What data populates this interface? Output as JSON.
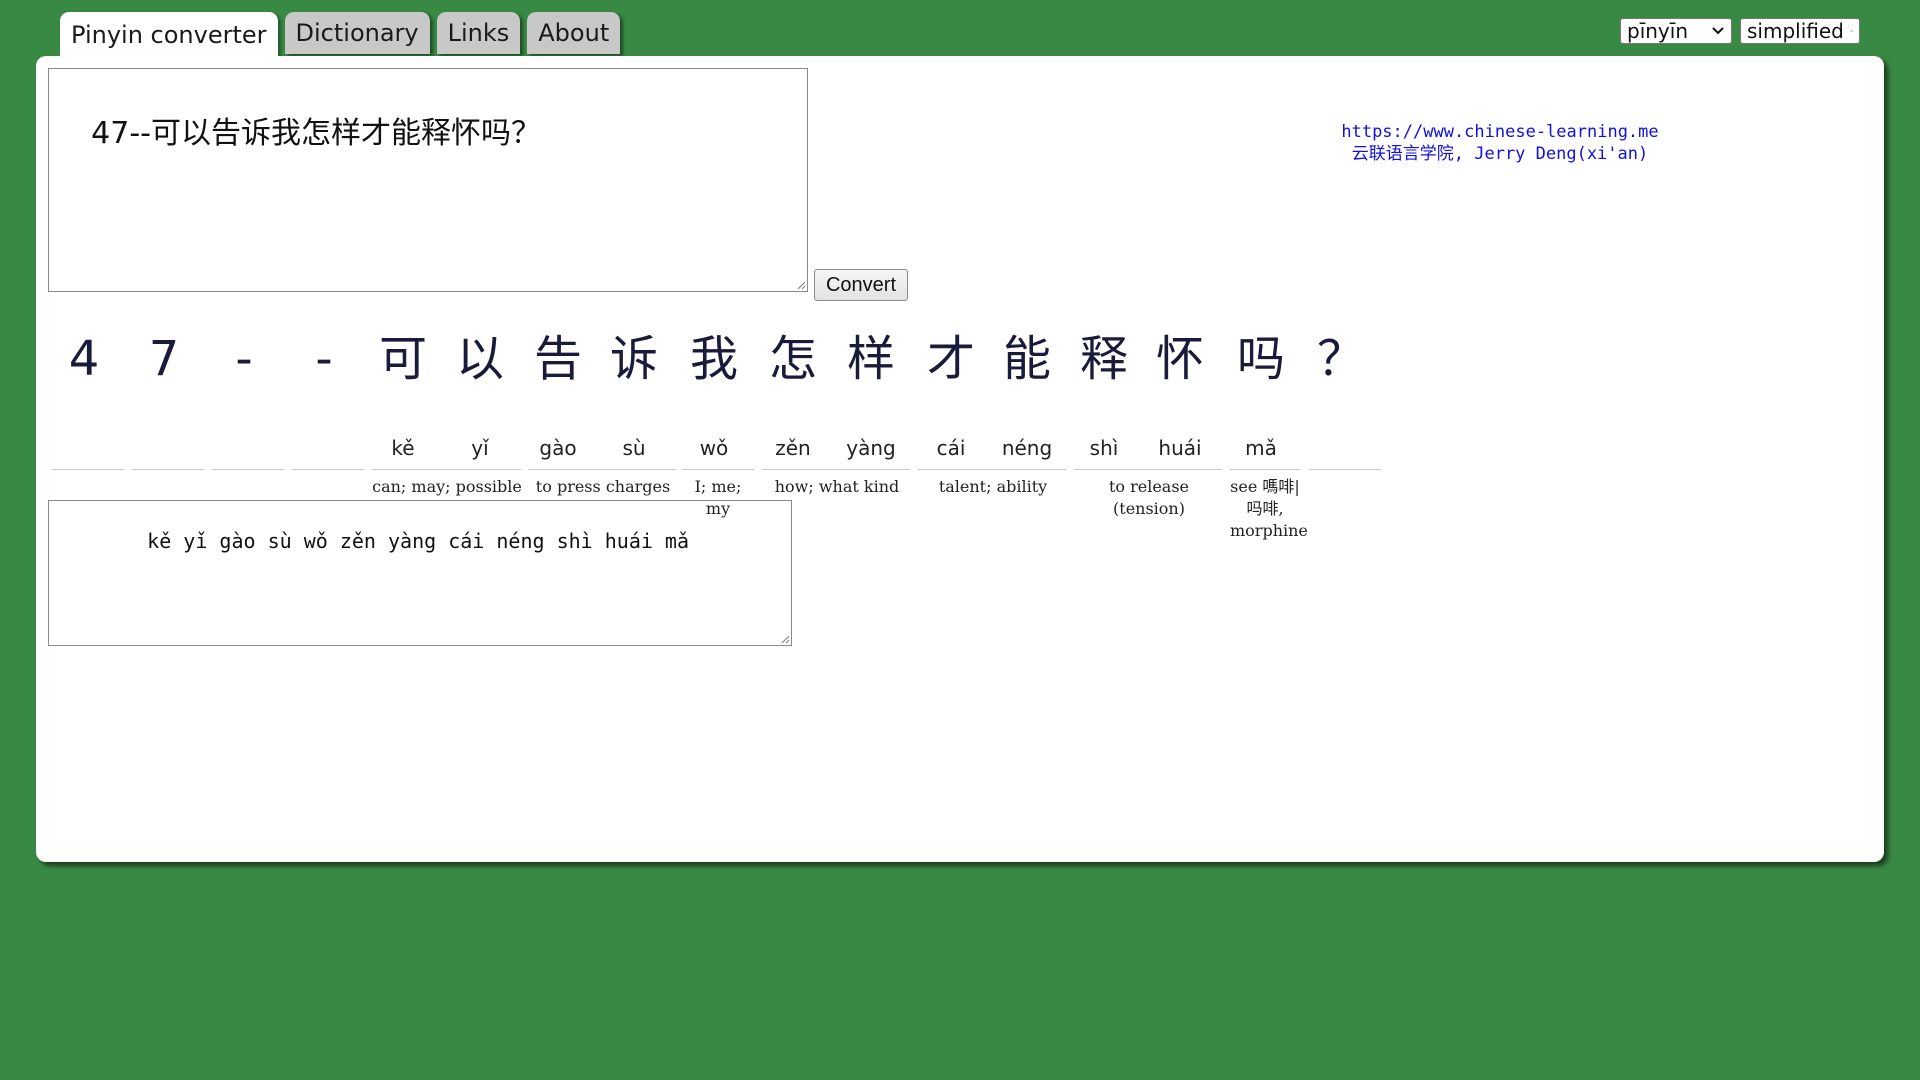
{
  "tabs": [
    {
      "label": "Pinyin converter",
      "active": true
    },
    {
      "label": "Dictionary",
      "active": false
    },
    {
      "label": "Links",
      "active": false
    },
    {
      "label": "About",
      "active": false
    }
  ],
  "selects": {
    "tone_mode": "pīnyīn",
    "script": "simplified"
  },
  "input": {
    "text": "47--可以告诉我怎样才能释怀吗？"
  },
  "convert_label": "Convert",
  "credit": {
    "url": "https://www.chinese-learning.me",
    "author": "云联语言学院, Jerry Deng(xi'an)"
  },
  "characters": [
    {
      "char": "4",
      "pinyin": ""
    },
    {
      "char": "7",
      "pinyin": ""
    },
    {
      "char": "-",
      "pinyin": ""
    },
    {
      "char": "-",
      "pinyin": ""
    },
    {
      "char": "可",
      "pinyin": "kě"
    },
    {
      "char": "以",
      "pinyin": "yǐ"
    },
    {
      "char": "告",
      "pinyin": "gào"
    },
    {
      "char": "诉",
      "pinyin": "sù"
    },
    {
      "char": "我",
      "pinyin": "wǒ"
    },
    {
      "char": "怎",
      "pinyin": "zěn"
    },
    {
      "char": "样",
      "pinyin": "yàng"
    },
    {
      "char": "才",
      "pinyin": "cái"
    },
    {
      "char": "能",
      "pinyin": "néng"
    },
    {
      "char": "释",
      "pinyin": "shì"
    },
    {
      "char": "怀",
      "pinyin": "huái"
    },
    {
      "char": "吗",
      "pinyin": "mǎ"
    },
    {
      "char": "？",
      "pinyin": ""
    }
  ],
  "definitions": [
    "can; may; possible",
    "to press charges",
    "I; me; my",
    "how; what kind",
    "talent; ability",
    "to release (tension)",
    "see 嗎啡|吗啡, morphine"
  ],
  "output": {
    "text": "kě yǐ gào sù wǒ zěn yàng cái néng shì huái mǎ"
  },
  "colors": {
    "background": "#388943",
    "panel": "#ffffff",
    "link": "#1010e0"
  }
}
